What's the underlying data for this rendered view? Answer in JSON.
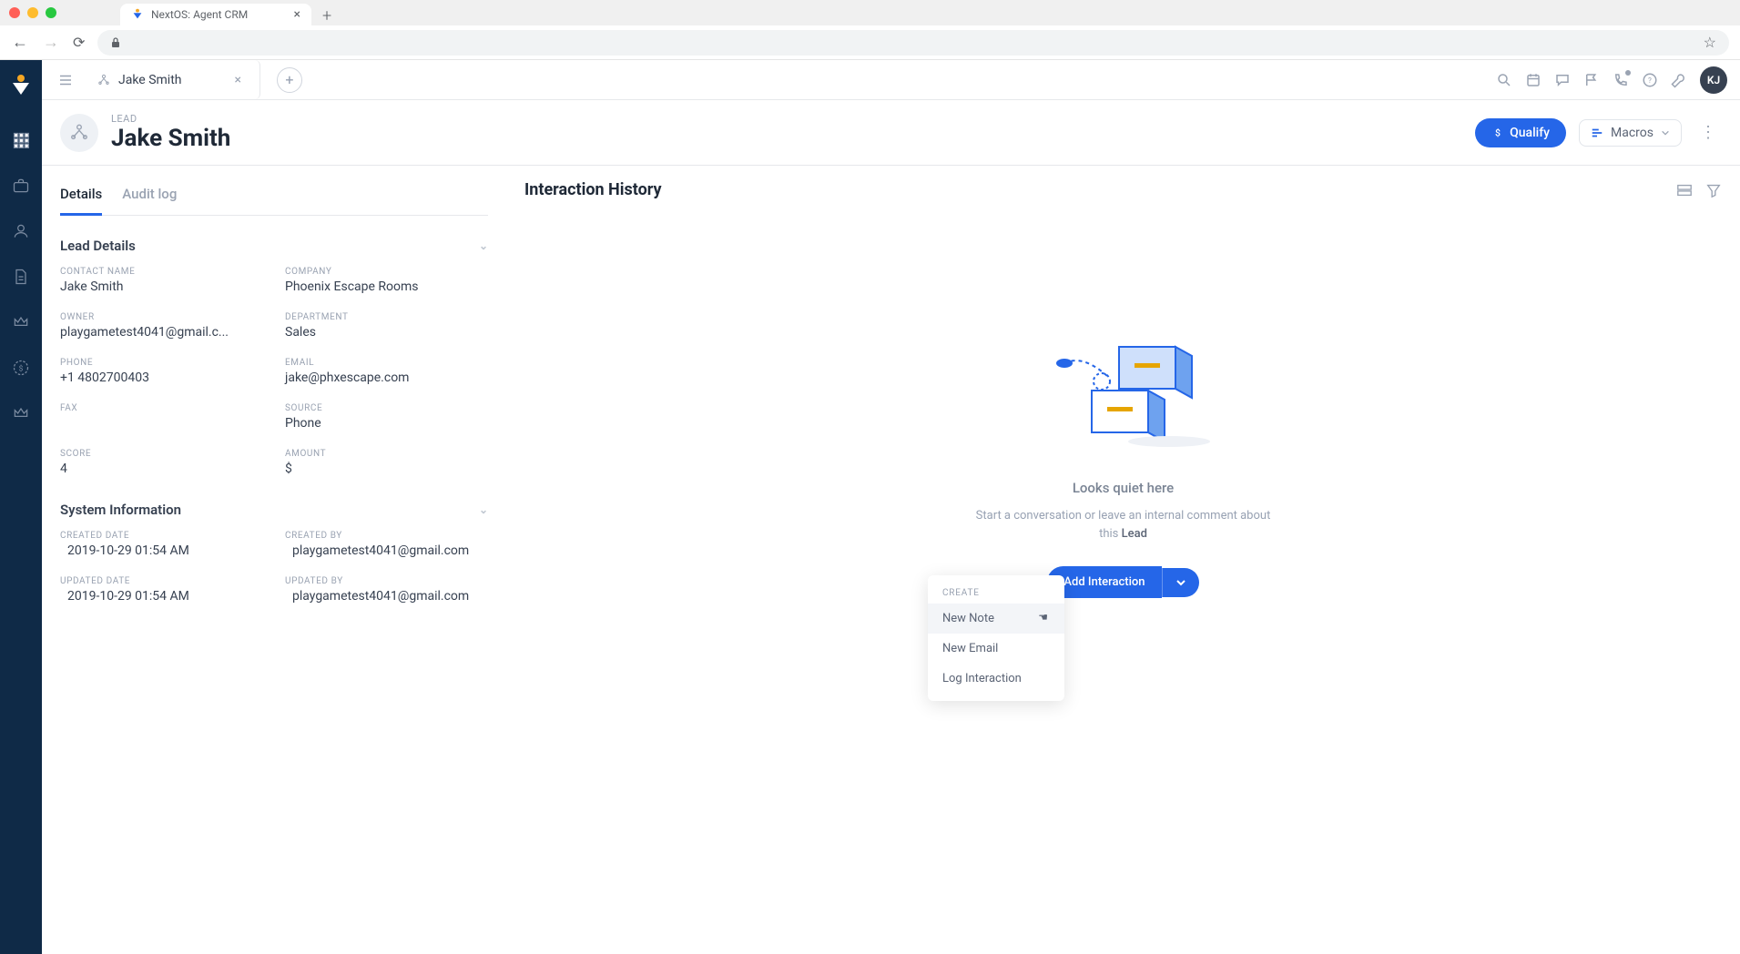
{
  "browser": {
    "tab_title": "NextOS: Agent CRM"
  },
  "top": {
    "workspace_tab_name": "Jake Smith",
    "avatar_initials": "KJ"
  },
  "record": {
    "type_label": "LEAD",
    "name": "Jake Smith",
    "qualify_label": "Qualify",
    "macros_label": "Macros"
  },
  "subtabs": {
    "details": "Details",
    "audit": "Audit log"
  },
  "sections": {
    "lead_details": {
      "title": "Lead Details",
      "fields": {
        "contact_name_label": "CONTACT NAME",
        "contact_name": "Jake Smith",
        "company_label": "COMPANY",
        "company": "Phoenix Escape Rooms",
        "owner_label": "OWNER",
        "owner": "playgametest4041@gmail.c...",
        "department_label": "DEPARTMENT",
        "department": "Sales",
        "phone_label": "PHONE",
        "phone": "+1 4802700403",
        "email_label": "EMAIL",
        "email": "jake@phxescape.com",
        "fax_label": "FAX",
        "fax": "",
        "source_label": "SOURCE",
        "source": "Phone",
        "score_label": "SCORE",
        "score": "4",
        "amount_label": "AMOUNT",
        "amount": "$"
      }
    },
    "system_info": {
      "title": "System Information",
      "fields": {
        "created_date_label": "CREATED DATE",
        "created_date": "2019-10-29 01:54 AM",
        "created_by_label": "CREATED BY",
        "created_by": "playgametest4041@gmail.com",
        "updated_date_label": "UPDATED DATE",
        "updated_date": "2019-10-29 01:54 AM",
        "updated_by_label": "UPDATED BY",
        "updated_by": "playgametest4041@gmail.com"
      }
    }
  },
  "right": {
    "title": "Interaction History",
    "empty_title": "Looks quiet here",
    "empty_sub_pre": "Start a conversation or leave an internal comment about this ",
    "empty_sub_strong": "Lead",
    "add_interaction_label": "Add Interaction"
  },
  "dropdown": {
    "header": "CREATE",
    "new_note": "New Note",
    "new_email": "New Email",
    "log_interaction": "Log Interaction"
  }
}
